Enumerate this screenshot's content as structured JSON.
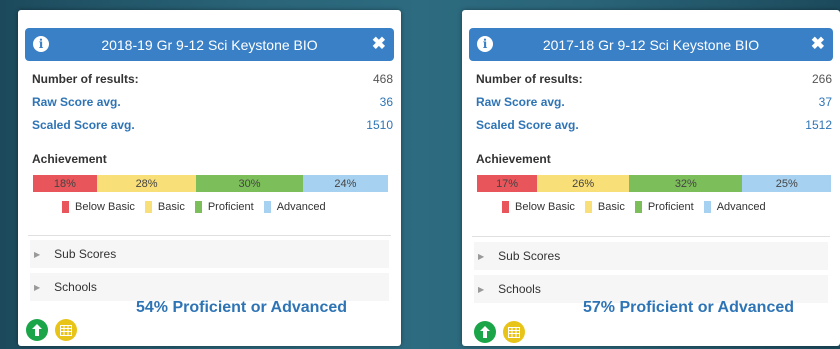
{
  "panels": [
    {
      "title": "2018-19 Gr 9-12 Sci Keystone BIO",
      "stats": [
        {
          "label": "Number of results:",
          "value": "468"
        },
        {
          "label": "Raw Score avg.",
          "value": "36"
        },
        {
          "label": "Scaled Score avg.",
          "value": "1510"
        }
      ],
      "achievement_label": "Achievement",
      "segments": [
        {
          "label": "18%",
          "value": 18
        },
        {
          "label": "28%",
          "value": 28
        },
        {
          "label": "30%",
          "value": 30
        },
        {
          "label": "24%",
          "value": 24
        }
      ],
      "sections": [
        "Sub Scores",
        "Schools"
      ],
      "summary": "54% Proficient or Advanced"
    },
    {
      "title": "2017-18 Gr 9-12 Sci Keystone BIO",
      "stats": [
        {
          "label": "Number of results:",
          "value": "266"
        },
        {
          "label": "Raw Score avg.",
          "value": "37"
        },
        {
          "label": "Scaled Score avg.",
          "value": "1512"
        }
      ],
      "achievement_label": "Achievement",
      "segments": [
        {
          "label": "17%",
          "value": 17
        },
        {
          "label": "26%",
          "value": 26
        },
        {
          "label": "32%",
          "value": 32
        },
        {
          "label": "25%",
          "value": 25
        }
      ],
      "sections": [
        "Sub Scores",
        "Schools"
      ],
      "summary": "57% Proficient or Advanced"
    }
  ],
  "legend": [
    "Below Basic",
    "Basic",
    "Proficient",
    "Advanced"
  ],
  "colors": {
    "below_basic": "#e8555a",
    "basic": "#f8df78",
    "proficient": "#7cbf5a",
    "advanced": "#a7d1f0",
    "title_bar": "#3a80c6",
    "summary_text": "#2e74b5",
    "green_button": "#1aa548",
    "yellow_button": "#e8c318"
  },
  "icons": {
    "info": "info-icon",
    "close": "close-icon",
    "caret": "caret-right-icon",
    "upload": "upload-icon",
    "table": "table-icon"
  }
}
